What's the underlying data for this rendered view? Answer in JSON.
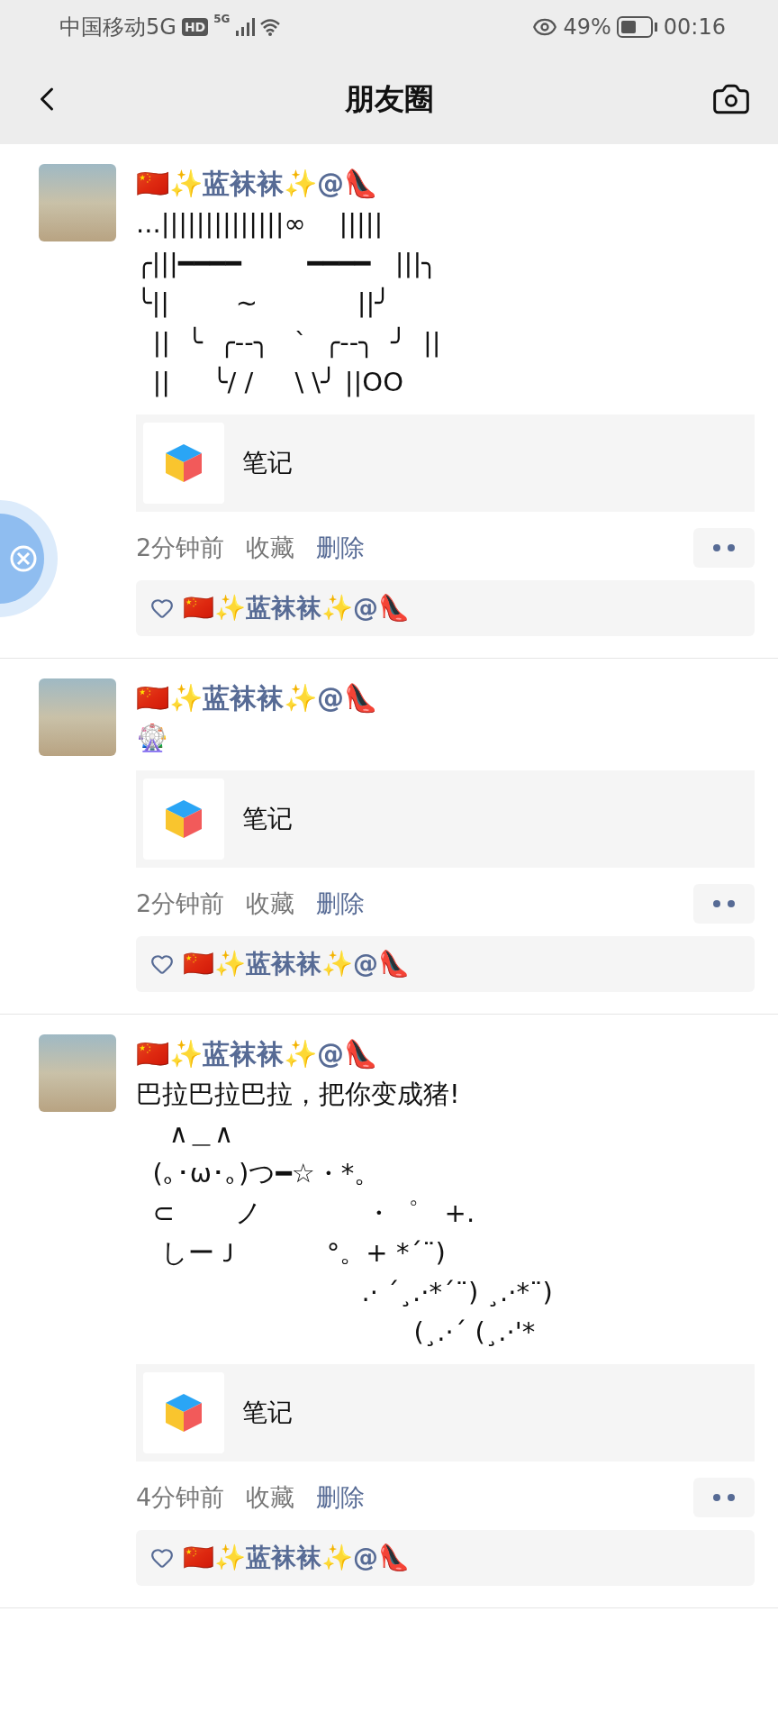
{
  "status_bar": {
    "carrier": "中国移动5G",
    "hd_badge": "HD",
    "network": "5G",
    "battery_percent": "49%",
    "time": "00:16"
  },
  "header": {
    "title": "朋友圈"
  },
  "posts": [
    {
      "author": "🇨🇳✨蓝袜袜✨@👠",
      "text_lines": [
        "...||||||||||||||∞    |||||",
        "╭|||━━━━        ━━━━   |||╮",
        "╰||        ~            ||╯",
        "  ||  ╰  ╭--╮   `  ╭--╮  ╯  ||",
        "  ||     ╰/ /     \\ \\╯ ||OO"
      ],
      "link": {
        "title": "笔记"
      },
      "time": "2分钟前",
      "favorite": "收藏",
      "delete": "删除",
      "likes": "🇨🇳✨蓝袜袜✨@👠"
    },
    {
      "author": "🇨🇳✨蓝袜袜✨@👠",
      "text_lines": [
        "🎡"
      ],
      "link": {
        "title": "笔记"
      },
      "time": "2分钟前",
      "favorite": "收藏",
      "delete": "删除",
      "likes": "🇨🇳✨蓝袜袜✨@👠"
    },
    {
      "author": "🇨🇳✨蓝袜袜✨@👠",
      "text_lines": [
        "巴拉巴拉巴拉，把你变成猪!",
        "    ∧＿∧",
        "  (｡･ω･｡)つ━☆・*。",
        "  ⊂　　 ノ 　　　  ・゜　+.",
        "   しーＪ　　　 °。+ *´¨)",
        "　　　　　　　　  .· ´¸.·*´¨) ¸.·*¨)",
        "　　　　　　　　　　  (¸.·´ (¸.·'*"
      ],
      "link": {
        "title": "笔记"
      },
      "time": "4分钟前",
      "favorite": "收藏",
      "delete": "删除",
      "likes": "🇨🇳✨蓝袜袜✨@👠"
    }
  ]
}
